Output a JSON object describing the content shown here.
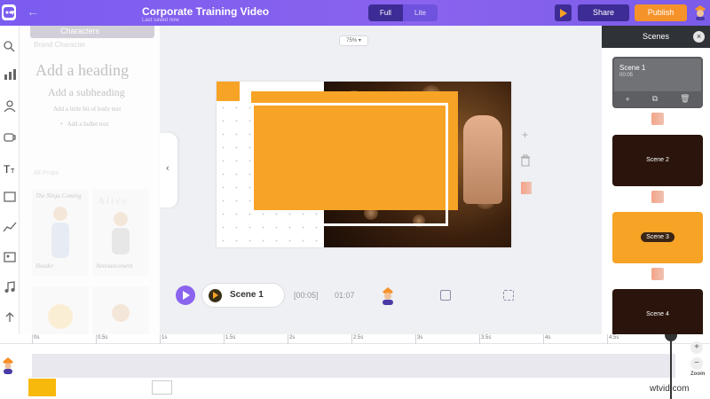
{
  "app": {
    "title": "Corporate Training Video",
    "subtitle": "Last saved now"
  },
  "toolbar": {
    "modes": [
      "Full",
      "Lite"
    ],
    "active_mode": "Full",
    "share_label": "Share",
    "publish_label": "Publish",
    "logo_caret": "▾",
    "back_icon": "←"
  },
  "assets": {
    "character_tab": "Characters",
    "brand_label": "Brand Character",
    "heading": "Add a heading",
    "subheading": "Add a subheading",
    "body": "Add a little bit of body text",
    "bullet": "Add a bullet text",
    "section_label": "All Props",
    "tiles": [
      {
        "caption": "The Ninja Coming"
      },
      {
        "caption": "Alive"
      },
      {
        "caption": "Header"
      },
      {
        "caption": "Announcement"
      }
    ]
  },
  "canvas": {
    "zoom": "75% ▾",
    "add_tool_glyph": "+"
  },
  "playback": {
    "scene_label": "Scene 1",
    "scene_time": "[00:05]",
    "total_time": "01:07"
  },
  "scenes": {
    "header": "Scenes",
    "close_glyph": "×",
    "items": [
      {
        "label": "Scene 1",
        "duration": "00:05"
      },
      {
        "label": "Scene 2"
      },
      {
        "label": "Scene 3"
      },
      {
        "label": "Scene 4"
      }
    ],
    "actions": [
      "+",
      "⧉",
      "🗑"
    ]
  },
  "timeline": {
    "ticks": [
      "0s",
      "0.5s",
      "1s",
      "1.5s",
      "2s",
      "2.5s",
      "3s",
      "3.5s",
      "4s",
      "4.5s"
    ],
    "zoom_in": "+",
    "zoom_out": "−",
    "zoom_label": "Zoom"
  },
  "colors": {
    "accent": "#8a63ee",
    "publish": "#f5922a",
    "brand_orange": "#f7a326",
    "scene_dark": "#2a140c"
  },
  "watermark": "wtvid.com"
}
